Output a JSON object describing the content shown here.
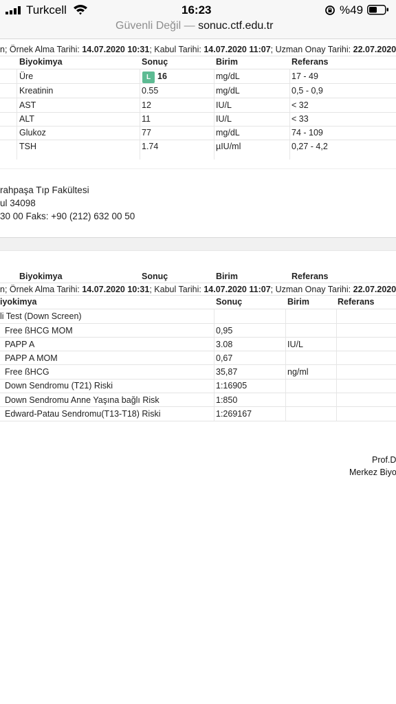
{
  "status_bar": {
    "carrier": "Turkcell",
    "time": "16:23",
    "battery": "%49"
  },
  "url_bar": {
    "security": "Güvenli Değil",
    "separator": "—",
    "host": "sonuc.ctf.edu.tr"
  },
  "report1": {
    "meta": {
      "prefix": "n;",
      "sample_label": "Örnek Alma Tarihi:",
      "sample_value": "14.07.2020 10:31",
      "accept_label": "; Kabul Tarihi:",
      "accept_value": "14.07.2020 11:07",
      "approve_label": "; Uzman Onay Tarihi:",
      "approve_value": "22.07.2020"
    },
    "headers": [
      "Biyokimya",
      "Sonuç",
      "Birim",
      "Referans"
    ],
    "badge": "L",
    "rows": [
      {
        "test": "Üre",
        "result": "16",
        "unit": "mg/dL",
        "ref": "17 - 49"
      },
      {
        "test": "Kreatinin",
        "result": "0.55",
        "unit": "mg/dL",
        "ref": "0,5 - 0,9"
      },
      {
        "test": "AST",
        "result": "12",
        "unit": "IU/L",
        "ref": "< 32"
      },
      {
        "test": "ALT",
        "result": "11",
        "unit": "IU/L",
        "ref": "< 33"
      },
      {
        "test": "Glukoz",
        "result": "77",
        "unit": "mg/dL",
        "ref": "74 - 109"
      },
      {
        "test": "TSH",
        "result": "1.74",
        "unit": "µIU/ml",
        "ref": "0,27 - 4,2"
      }
    ]
  },
  "footer_address": {
    "line1": "rahpaşa Tıp Fakültesi",
    "line2": "ul 34098",
    "line3": "30 00 Faks: +90 (212) 632 00 50"
  },
  "report2": {
    "headers_top": [
      "Biyokimya",
      "Sonuç",
      "Birim",
      "Referans"
    ],
    "meta": {
      "prefix": "n;",
      "sample_label": "Örnek Alma Tarihi:",
      "sample_value": "14.07.2020 10:31",
      "accept_label": "; Kabul Tarihi:",
      "accept_value": "14.07.2020 11:07",
      "approve_label": "; Uzman Onay Tarihi:",
      "approve_value": "22.07.2020"
    },
    "headers": [
      "iyokimya",
      "Sonuç",
      "Birim",
      "Referans"
    ],
    "group_title": "li Test (Down Screen)",
    "rows": [
      {
        "test": "Free ßHCG MOM",
        "result": "0,95",
        "unit": "",
        "ref": ""
      },
      {
        "test": "PAPP A",
        "result": "3.08",
        "unit": "IU/L",
        "ref": ""
      },
      {
        "test": "PAPP A MOM",
        "result": "0,67",
        "unit": "",
        "ref": ""
      },
      {
        "test": "Free ßHCG",
        "result": "35,87",
        "unit": "ng/ml",
        "ref": ""
      },
      {
        "test": "Down Sendromu (T21) Riski",
        "result": "1:16905",
        "unit": "",
        "ref": ""
      },
      {
        "test": "Down Sendromu Anne Yaşına bağlı Risk",
        "result": "1:850",
        "unit": "",
        "ref": ""
      },
      {
        "test": "Edward-Patau Sendromu(T13-T18) Riski",
        "result": "1:269167",
        "unit": "",
        "ref": ""
      }
    ]
  },
  "signature": {
    "line1": "Prof.D",
    "line2": "Merkez Biyo"
  },
  "colors": {
    "badge_low": "#5dbb93",
    "chrome": "#f7f7f7"
  },
  "icons": [
    "signal-icon",
    "wifi-icon",
    "orientation-lock-icon",
    "battery-icon"
  ]
}
